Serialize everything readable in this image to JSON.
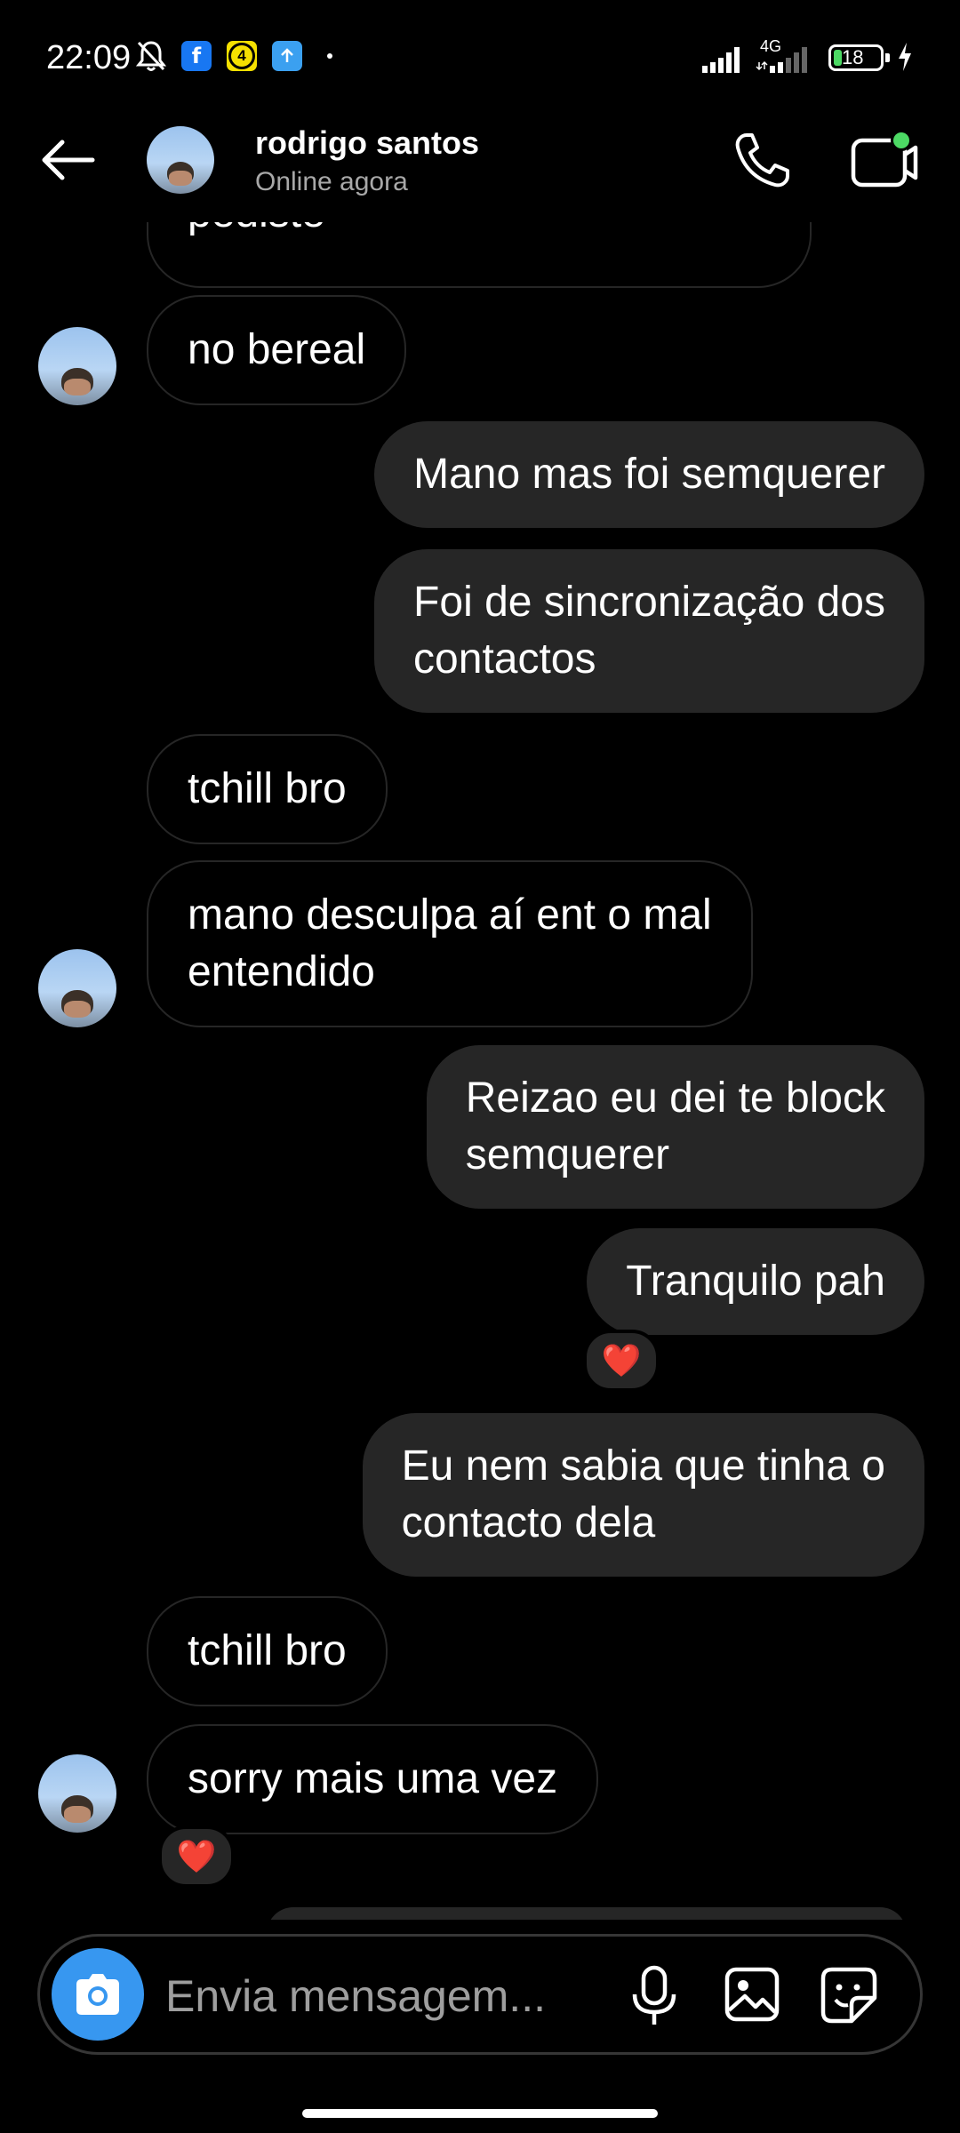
{
  "status_bar": {
    "time": "22:09",
    "network": "4G",
    "battery": "18",
    "battery_level": 0.18,
    "notification_badge": "4",
    "icons": [
      "mute-bell-icon",
      "facebook-icon",
      "notification-count-icon",
      "upload-icon",
      "signal-icon",
      "battery-icon",
      "charging-icon"
    ]
  },
  "header": {
    "name": "rodrigo santos",
    "status": "Online agora",
    "icons": [
      "back-arrow-icon",
      "phone-icon",
      "video-call-icon"
    ],
    "online_dot_color": "#4cd964"
  },
  "messages": [
    {
      "direction": "in",
      "text": "pediste"
    },
    {
      "direction": "in",
      "text": "no bereal"
    },
    {
      "direction": "out",
      "text": "Mano mas foi semquerer"
    },
    {
      "direction": "out",
      "lines": [
        "Foi de sincronização dos",
        "contactos"
      ]
    },
    {
      "direction": "in",
      "text": "tchill bro"
    },
    {
      "direction": "in",
      "lines": [
        "mano desculpa aí ent o mal",
        "entendido"
      ]
    },
    {
      "direction": "out",
      "lines": [
        "Reizao eu dei te block",
        "semquerer"
      ]
    },
    {
      "direction": "out",
      "text": "Tranquilo pah",
      "reaction": "❤️"
    },
    {
      "direction": "out",
      "lines": [
        "Eu nem sabia que tinha o",
        "contacto dela"
      ]
    },
    {
      "direction": "in",
      "text": "tchill bro"
    },
    {
      "direction": "in",
      "text": "sorry mais uma vez",
      "reaction": "❤️"
    }
  ],
  "composer": {
    "placeholder": "Envia mensagem...",
    "icons": [
      "camera-icon",
      "microphone-icon",
      "gallery-icon",
      "sticker-icon"
    ]
  },
  "colors": {
    "background": "#000000",
    "bubble_out": "#262626",
    "bubble_in_border": "#262626",
    "accent": "#3797f0",
    "reaction": "#ff3040"
  }
}
